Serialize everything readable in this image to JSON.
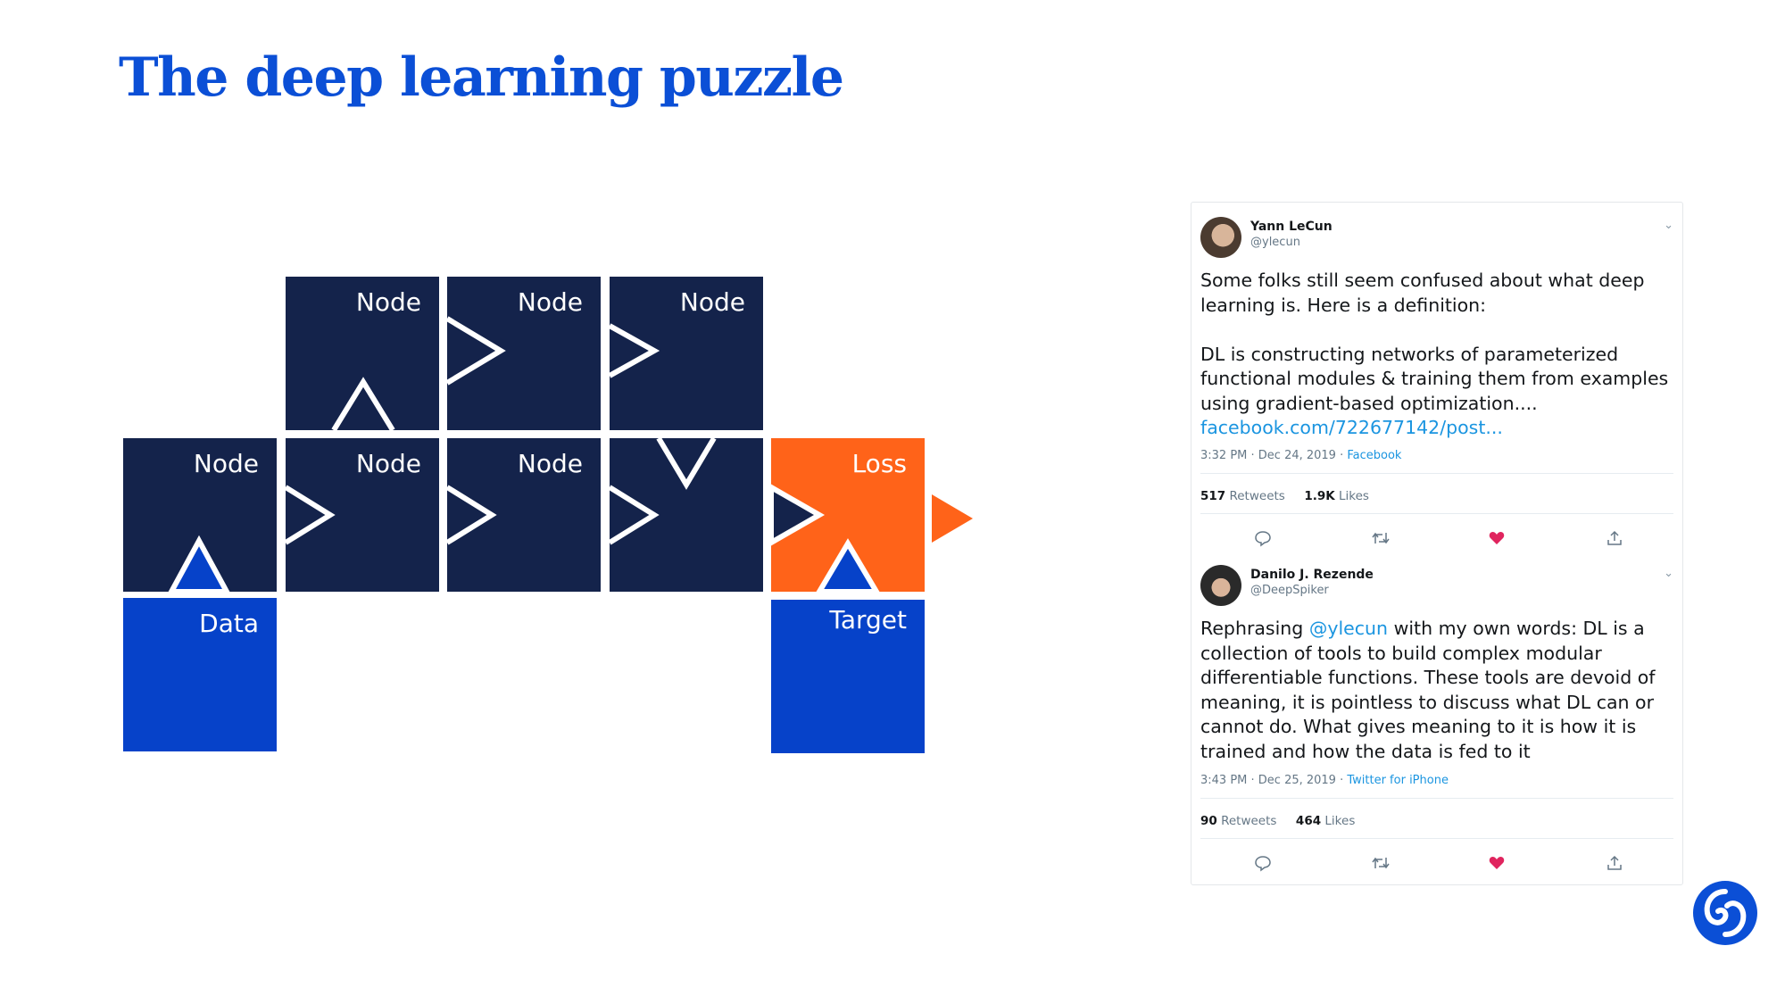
{
  "slide": {
    "title": "The deep learning puzzle"
  },
  "diagram": {
    "nodes": {
      "n_top1": "Node",
      "n_top2": "Node",
      "n_top3": "Node",
      "n_mid0": "Node",
      "n_mid1": "Node",
      "n_mid2": "Node",
      "loss": "Loss",
      "data": "Data",
      "target": "Target"
    },
    "colors": {
      "node": "#14234b",
      "io": "#0642c9",
      "loss": "#ff6319",
      "title": "#0b4fd6"
    }
  },
  "tweets": [
    {
      "author": "Yann LeCun",
      "handle": "@ylecun",
      "text_p1": "Some folks still seem confused about what deep learning is. Here is a definition:",
      "text_p2": "DL is constructing networks of parameterized functional modules & training them from examples using gradient-based optimization....",
      "link": "facebook.com/722677142/post...",
      "time": "3:32 PM · Dec 24, 2019 · ",
      "source": "Facebook",
      "retweets": "517",
      "retweets_label": " Retweets",
      "likes": "1.9K",
      "likes_label": " Likes"
    },
    {
      "author": "Danilo J. Rezende",
      "handle": "@DeepSpiker",
      "text_pre": "Rephrasing ",
      "mention": "@ylecun",
      "text_post": " with my own words: DL is a collection of tools to build complex modular differentiable functions. These tools are devoid of meaning, it is pointless to discuss what DL can or cannot do. What gives meaning to it is how it is trained and how the data is fed to it",
      "time": "3:43 PM · Dec 25, 2019 · ",
      "source": "Twitter for iPhone",
      "retweets": "90",
      "retweets_label": " Retweets",
      "likes": "464",
      "likes_label": " Likes"
    }
  ],
  "icons": {
    "reply": "reply-icon",
    "retweet": "retweet-icon",
    "like": "heart-icon",
    "share": "share-icon",
    "menu": "chevron-down-icon",
    "logo": "deepmind-logo-icon"
  }
}
